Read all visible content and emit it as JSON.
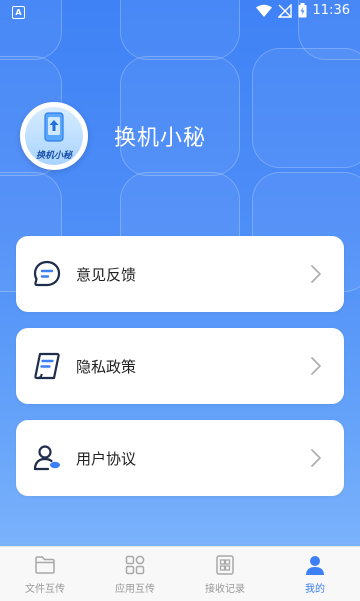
{
  "status_bar": {
    "notification_badge": "A",
    "time": "11:36"
  },
  "profile": {
    "logo_text": "换机小秘",
    "app_name": "换机小秘"
  },
  "menu": {
    "items": [
      {
        "label": "意见反馈",
        "icon": "feedback-icon"
      },
      {
        "label": "隐私政策",
        "icon": "privacy-policy-icon"
      },
      {
        "label": "用户协议",
        "icon": "user-agreement-icon"
      }
    ]
  },
  "tabbar": {
    "tabs": [
      {
        "label": "文件互传",
        "icon": "folder-icon",
        "active": false
      },
      {
        "label": "应用互传",
        "icon": "apps-icon",
        "active": false
      },
      {
        "label": "接收记录",
        "icon": "records-icon",
        "active": false
      },
      {
        "label": "我的",
        "icon": "profile-icon",
        "active": true
      }
    ]
  },
  "colors": {
    "accent": "#3d7ff5",
    "background_top": "#3f82f6",
    "background_bottom": "#7ab2fb",
    "icon_dark": "#1f2d4d",
    "icon_accent": "#3d7ff5"
  }
}
